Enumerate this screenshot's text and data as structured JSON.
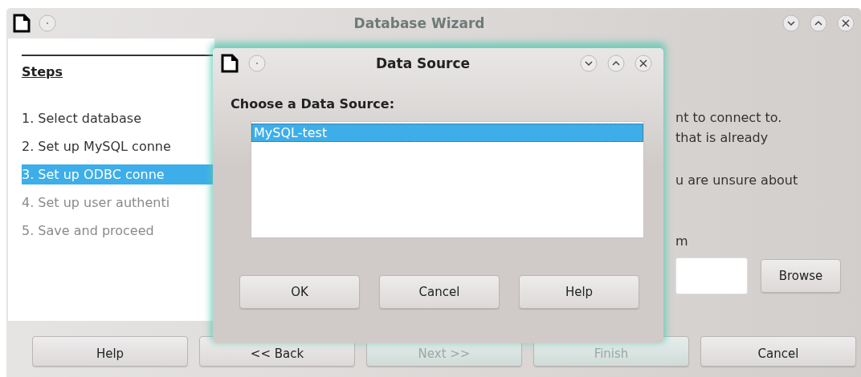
{
  "window": {
    "title": "Database Wizard"
  },
  "steps": {
    "heading": "Steps",
    "items": [
      {
        "label": "1. Select database",
        "selected": false,
        "disabled": false
      },
      {
        "label": "2. Set up MySQL conne",
        "selected": false,
        "disabled": false
      },
      {
        "label": "3. Set up ODBC conne",
        "selected": true,
        "disabled": false
      },
      {
        "label": "4. Set up user authenti",
        "selected": false,
        "disabled": true
      },
      {
        "label": "5. Save and proceed",
        "selected": false,
        "disabled": true
      }
    ]
  },
  "description": [
    "nt to connect to.",
    "that is already",
    "u are unsure about"
  ],
  "path_label": "m",
  "browse_button": "Browse",
  "buttons": [
    {
      "label": "Help",
      "disabled": false
    },
    {
      "label": "<< Back",
      "disabled": false
    },
    {
      "label": "Next >>",
      "disabled": true
    },
    {
      "label": "Finish",
      "disabled": true
    },
    {
      "label": "Cancel",
      "disabled": false
    }
  ],
  "dialog": {
    "title": "Data Source",
    "prompt": "Choose a Data Source:",
    "sources": [
      {
        "label": "MySQL-test",
        "selected": true
      }
    ],
    "buttons": [
      "OK",
      "Cancel",
      "Help"
    ]
  }
}
